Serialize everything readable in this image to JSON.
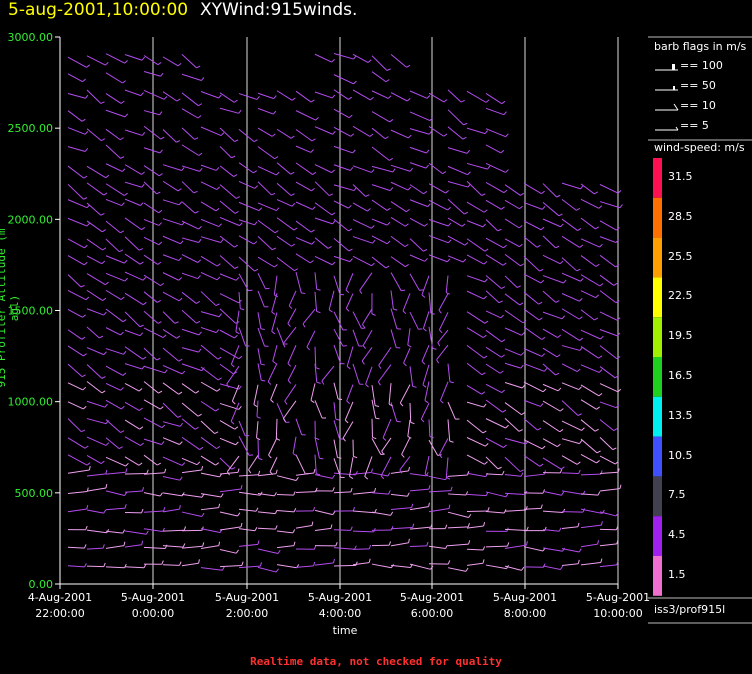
{
  "header": {
    "date": "5-aug-2001,10:00:00",
    "name": "XYWind:915winds."
  },
  "colors": {
    "title_date": "#ffff00",
    "y_tick": "#33ee33",
    "footer": "#ff3030",
    "barb_main": "#b44cf0",
    "barb_light": "#f0a0f0"
  },
  "chart_data": {
    "type": "wind-barb time-height",
    "ylabel": "915 Profiler Altitude (m agl)",
    "xlabel": "time",
    "ylim": [
      0,
      3000
    ],
    "yticks": [
      "0.00",
      "500.00",
      "1000.00",
      "1500.00",
      "2000.00",
      "2500.00",
      "3000.00"
    ],
    "xticks": [
      {
        "date": "4-Aug-2001",
        "time": "22:00:00"
      },
      {
        "date": "5-Aug-2001",
        "time": "0:00:00"
      },
      {
        "date": "5-Aug-2001",
        "time": "2:00:00"
      },
      {
        "date": "5-Aug-2001",
        "time": "4:00:00"
      },
      {
        "date": "5-Aug-2001",
        "time": "6:00:00"
      },
      {
        "date": "5-Aug-2001",
        "time": "8:00:00"
      },
      {
        "date": "5-Aug-2001",
        "time": "10:00:00"
      }
    ],
    "grid": "vertical at each time tick",
    "barb_legend": {
      "title": "barb flags in m/s",
      "items": [
        "== 100",
        "== 50",
        "== 10",
        "== 5"
      ]
    },
    "speed_legend": {
      "title": "wind-speed: m/s",
      "bins": [
        {
          "label": "31.5",
          "color": "#ff1050"
        },
        {
          "label": "28.5",
          "color": "#ff7000"
        },
        {
          "label": "25.5",
          "color": "#ffa000"
        },
        {
          "label": "22.5",
          "color": "#ffff00"
        },
        {
          "label": "19.5",
          "color": "#a0f000"
        },
        {
          "label": "16.5",
          "color": "#20d020"
        },
        {
          "label": "13.5",
          "color": "#00f0f0"
        },
        {
          "label": "10.5",
          "color": "#4050ff"
        },
        {
          "label": "7.5",
          "color": "#404050"
        },
        {
          "label": "4.5",
          "color": "#a020f0"
        },
        {
          "label": "1.5",
          "color": "#f070d0"
        }
      ]
    },
    "station": "iss3/prof915l"
  },
  "footer": "Realtime data, not checked for quality"
}
